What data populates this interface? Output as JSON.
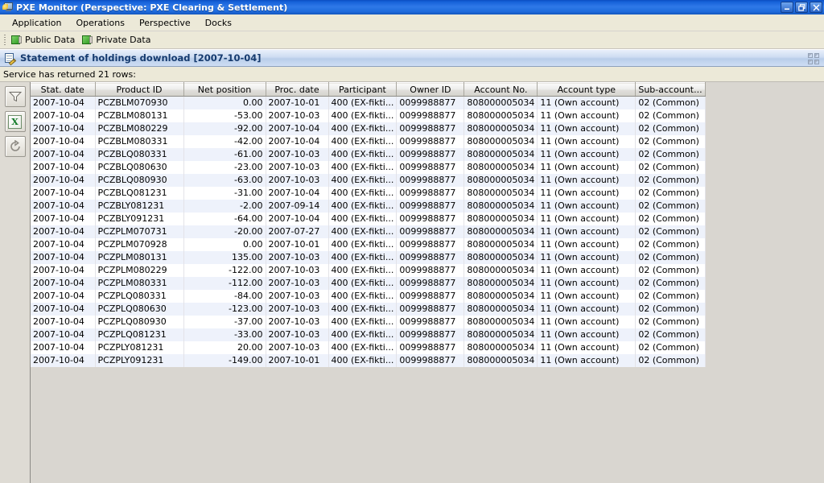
{
  "window": {
    "title": "PXE Monitor (Perspective: PXE Clearing & Settlement)",
    "icon": "monitor-icon",
    "buttons": {
      "minimize": "minimize-button",
      "restore": "restore-button",
      "close": "close-button"
    }
  },
  "menubar": {
    "items": [
      {
        "label": "Application"
      },
      {
        "label": "Operations"
      },
      {
        "label": "Perspective"
      },
      {
        "label": "Docks"
      }
    ]
  },
  "toolbar": {
    "items": [
      {
        "label": "Public Data",
        "icon": "green-data-icon"
      },
      {
        "label": "Private Data",
        "icon": "green-data-icon"
      }
    ]
  },
  "panel": {
    "icon": "document-edit-icon",
    "title": "Statement of holdings download [2007-10-04]",
    "maximize_icon": "maximize-panel-icon"
  },
  "status": {
    "message": "Service has returned 21 rows:"
  },
  "sidebar": {
    "buttons": [
      {
        "name": "filter-button",
        "icon": "funnel-icon"
      },
      {
        "name": "export-excel-button",
        "icon": "excel-icon",
        "glyph": "X"
      },
      {
        "name": "refresh-button",
        "icon": "refresh-icon"
      }
    ]
  },
  "table": {
    "columns": [
      "Stat. date",
      "Product ID",
      "Net position",
      "Proc. date",
      "Participant",
      "Owner ID",
      "Account No.",
      "Account type",
      "Sub-account..."
    ],
    "rows": [
      [
        "2007-10-04",
        "PCZBLM070930",
        "0.00",
        "2007-10-01",
        "400 (EX-fikti...",
        "0099988877",
        "808000005034",
        "11 (Own account)",
        "02 (Common)"
      ],
      [
        "2007-10-04",
        "PCZBLM080131",
        "-53.00",
        "2007-10-03",
        "400 (EX-fikti...",
        "0099988877",
        "808000005034",
        "11 (Own account)",
        "02 (Common)"
      ],
      [
        "2007-10-04",
        "PCZBLM080229",
        "-92.00",
        "2007-10-04",
        "400 (EX-fikti...",
        "0099988877",
        "808000005034",
        "11 (Own account)",
        "02 (Common)"
      ],
      [
        "2007-10-04",
        "PCZBLM080331",
        "-42.00",
        "2007-10-04",
        "400 (EX-fikti...",
        "0099988877",
        "808000005034",
        "11 (Own account)",
        "02 (Common)"
      ],
      [
        "2007-10-04",
        "PCZBLQ080331",
        "-61.00",
        "2007-10-03",
        "400 (EX-fikti...",
        "0099988877",
        "808000005034",
        "11 (Own account)",
        "02 (Common)"
      ],
      [
        "2007-10-04",
        "PCZBLQ080630",
        "-23.00",
        "2007-10-03",
        "400 (EX-fikti...",
        "0099988877",
        "808000005034",
        "11 (Own account)",
        "02 (Common)"
      ],
      [
        "2007-10-04",
        "PCZBLQ080930",
        "-63.00",
        "2007-10-03",
        "400 (EX-fikti...",
        "0099988877",
        "808000005034",
        "11 (Own account)",
        "02 (Common)"
      ],
      [
        "2007-10-04",
        "PCZBLQ081231",
        "-31.00",
        "2007-10-04",
        "400 (EX-fikti...",
        "0099988877",
        "808000005034",
        "11 (Own account)",
        "02 (Common)"
      ],
      [
        "2007-10-04",
        "PCZBLY081231",
        "-2.00",
        "2007-09-14",
        "400 (EX-fikti...",
        "0099988877",
        "808000005034",
        "11 (Own account)",
        "02 (Common)"
      ],
      [
        "2007-10-04",
        "PCZBLY091231",
        "-64.00",
        "2007-10-04",
        "400 (EX-fikti...",
        "0099988877",
        "808000005034",
        "11 (Own account)",
        "02 (Common)"
      ],
      [
        "2007-10-04",
        "PCZPLM070731",
        "-20.00",
        "2007-07-27",
        "400 (EX-fikti...",
        "0099988877",
        "808000005034",
        "11 (Own account)",
        "02 (Common)"
      ],
      [
        "2007-10-04",
        "PCZPLM070928",
        "0.00",
        "2007-10-01",
        "400 (EX-fikti...",
        "0099988877",
        "808000005034",
        "11 (Own account)",
        "02 (Common)"
      ],
      [
        "2007-10-04",
        "PCZPLM080131",
        "135.00",
        "2007-10-03",
        "400 (EX-fikti...",
        "0099988877",
        "808000005034",
        "11 (Own account)",
        "02 (Common)"
      ],
      [
        "2007-10-04",
        "PCZPLM080229",
        "-122.00",
        "2007-10-03",
        "400 (EX-fikti...",
        "0099988877",
        "808000005034",
        "11 (Own account)",
        "02 (Common)"
      ],
      [
        "2007-10-04",
        "PCZPLM080331",
        "-112.00",
        "2007-10-03",
        "400 (EX-fikti...",
        "0099988877",
        "808000005034",
        "11 (Own account)",
        "02 (Common)"
      ],
      [
        "2007-10-04",
        "PCZPLQ080331",
        "-84.00",
        "2007-10-03",
        "400 (EX-fikti...",
        "0099988877",
        "808000005034",
        "11 (Own account)",
        "02 (Common)"
      ],
      [
        "2007-10-04",
        "PCZPLQ080630",
        "-123.00",
        "2007-10-03",
        "400 (EX-fikti...",
        "0099988877",
        "808000005034",
        "11 (Own account)",
        "02 (Common)"
      ],
      [
        "2007-10-04",
        "PCZPLQ080930",
        "-37.00",
        "2007-10-03",
        "400 (EX-fikti...",
        "0099988877",
        "808000005034",
        "11 (Own account)",
        "02 (Common)"
      ],
      [
        "2007-10-04",
        "PCZPLQ081231",
        "-33.00",
        "2007-10-03",
        "400 (EX-fikti...",
        "0099988877",
        "808000005034",
        "11 (Own account)",
        "02 (Common)"
      ],
      [
        "2007-10-04",
        "PCZPLY081231",
        "20.00",
        "2007-10-03",
        "400 (EX-fikti...",
        "0099988877",
        "808000005034",
        "11 (Own account)",
        "02 (Common)"
      ],
      [
        "2007-10-04",
        "PCZPLY091231",
        "-149.00",
        "2007-10-01",
        "400 (EX-fikti...",
        "0099988877",
        "808000005034",
        "11 (Own account)",
        "02 (Common)"
      ]
    ]
  },
  "colors": {
    "negative": "#c40018",
    "positive": "#137a18",
    "title_bar": "#1560d8",
    "panel_header": "#cddcf2",
    "row_alt": "#eef2fb"
  }
}
